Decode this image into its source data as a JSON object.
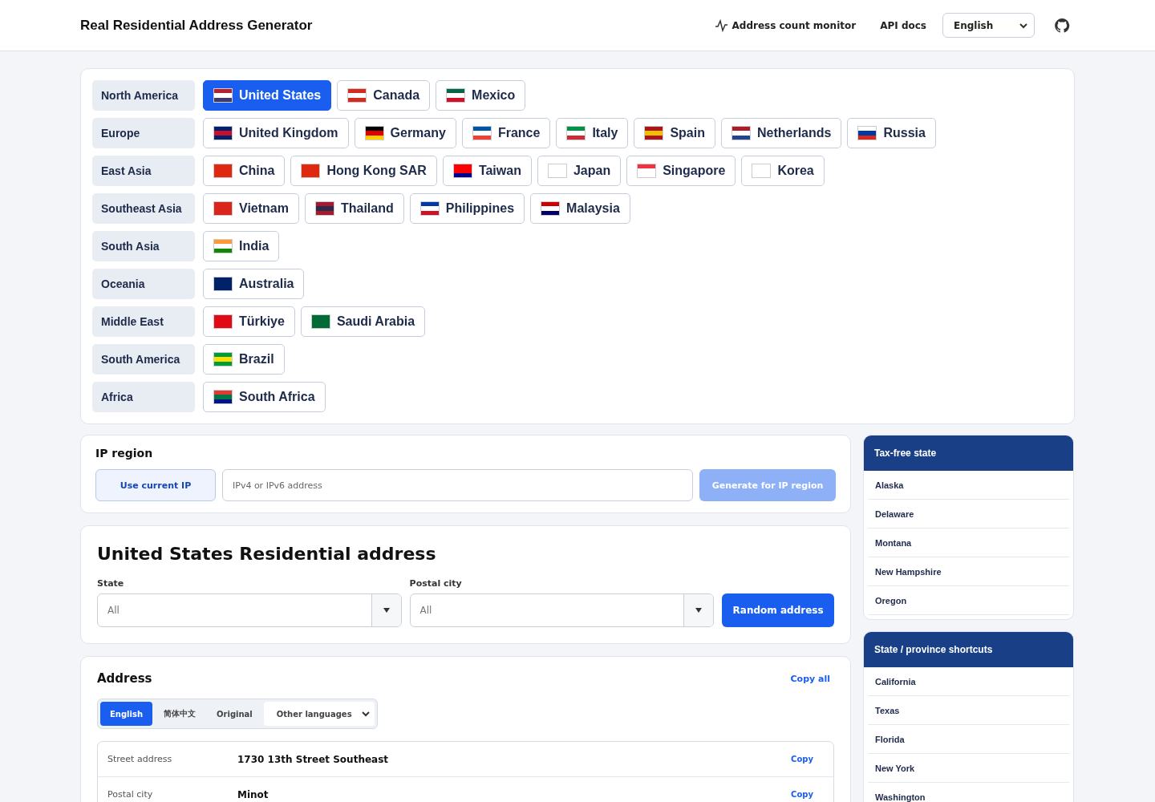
{
  "header": {
    "title": "Real Residential Address Generator",
    "nav": [
      {
        "label": "Address count monitor",
        "kind": "monitor"
      },
      {
        "label": "API docs",
        "kind": "plain"
      }
    ],
    "language": "English"
  },
  "regions": [
    {
      "name": "North America",
      "countries": [
        {
          "label": "United States",
          "selected": true
        },
        {
          "label": "Canada",
          "selected": false
        },
        {
          "label": "Mexico",
          "selected": false
        }
      ]
    },
    {
      "name": "Europe",
      "countries": [
        {
          "label": "United Kingdom",
          "selected": false
        },
        {
          "label": "Germany",
          "selected": false
        },
        {
          "label": "France",
          "selected": false
        },
        {
          "label": "Italy",
          "selected": false
        },
        {
          "label": "Spain",
          "selected": false
        },
        {
          "label": "Netherlands",
          "selected": false
        },
        {
          "label": "Russia",
          "selected": false
        }
      ]
    },
    {
      "name": "East Asia",
      "countries": [
        {
          "label": "China",
          "selected": false
        },
        {
          "label": "Hong Kong SAR",
          "selected": false
        },
        {
          "label": "Taiwan",
          "selected": false
        },
        {
          "label": "Japan",
          "selected": false
        },
        {
          "label": "Singapore",
          "selected": false
        },
        {
          "label": "Korea",
          "selected": false
        }
      ]
    },
    {
      "name": "Southeast Asia",
      "countries": [
        {
          "label": "Vietnam",
          "selected": false
        },
        {
          "label": "Thailand",
          "selected": false
        },
        {
          "label": "Philippines",
          "selected": false
        },
        {
          "label": "Malaysia",
          "selected": false
        }
      ]
    },
    {
      "name": "South Asia",
      "countries": [
        {
          "label": "India",
          "selected": false
        }
      ]
    },
    {
      "name": "Oceania",
      "countries": [
        {
          "label": "Australia",
          "selected": false
        }
      ]
    },
    {
      "name": "Middle East",
      "countries": [
        {
          "label": "Türkiye",
          "selected": false
        },
        {
          "label": "Saudi Arabia",
          "selected": false
        }
      ]
    },
    {
      "name": "South America",
      "countries": [
        {
          "label": "Brazil",
          "selected": false
        }
      ]
    },
    {
      "name": "Africa",
      "countries": [
        {
          "label": "South Africa",
          "selected": false
        }
      ]
    }
  ],
  "ip_region": {
    "title": "IP region",
    "use_current": "Use current IP",
    "placeholder": "IPv4 or IPv6 address",
    "generate": "Generate for IP region",
    "generate_disabled": true
  },
  "form": {
    "title": "United States Residential address",
    "fields": [
      {
        "label": "State",
        "value": "All"
      },
      {
        "label": "Postal city",
        "value": "All"
      }
    ],
    "button": "Random address"
  },
  "address": {
    "title": "Address",
    "copy_all": "Copy all",
    "tabs": [
      {
        "label": "English",
        "selected": true
      },
      {
        "label": "简体中文",
        "selected": false
      },
      {
        "label": "Original",
        "selected": false
      }
    ],
    "other_languages": "Other languages",
    "rows": [
      {
        "label": "Street address",
        "value": "1730 13th Street Southeast",
        "copy": "Copy"
      },
      {
        "label": "Postal city",
        "value": "Minot",
        "copy": "Copy"
      }
    ]
  },
  "sidebar": [
    {
      "title": "Tax-free state",
      "items": [
        "Alaska",
        "Delaware",
        "Montana",
        "New Hampshire",
        "Oregon"
      ]
    },
    {
      "title": "State / province shortcuts",
      "items": [
        "California",
        "Texas",
        "Florida",
        "New York",
        "Washington"
      ]
    }
  ]
}
